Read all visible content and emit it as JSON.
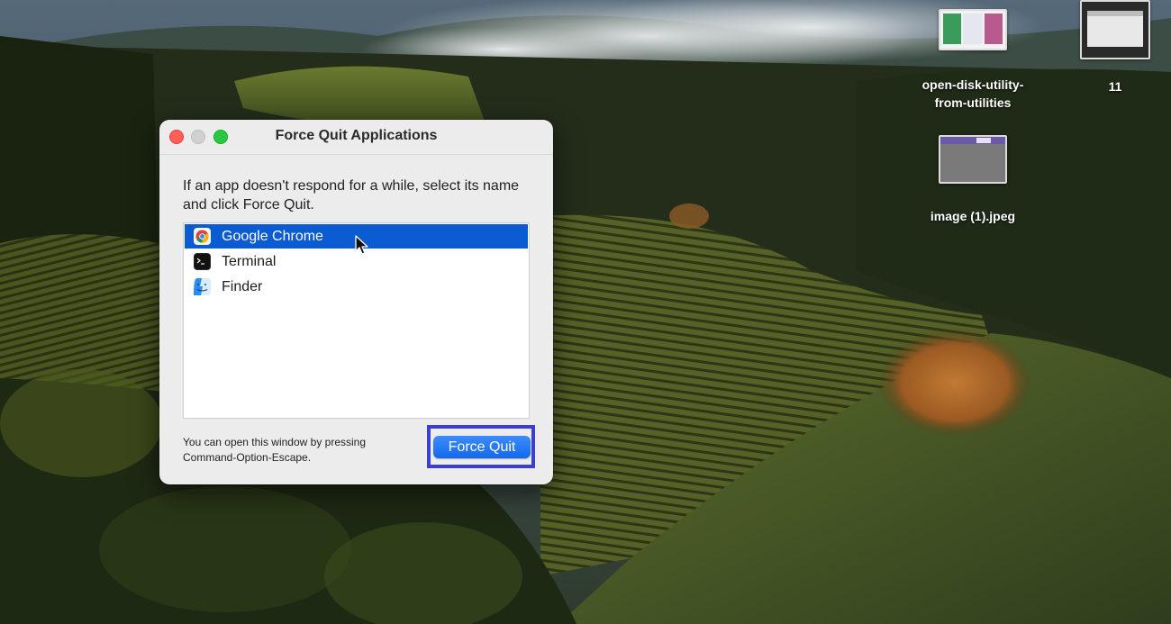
{
  "desktop": {
    "icons": [
      {
        "label_line1": "open-disk-utility-",
        "label_line2": "from-utilities"
      },
      {
        "label": "11"
      },
      {
        "label": "image (1).jpeg"
      }
    ]
  },
  "force_quit_window": {
    "title": "Force Quit Applications",
    "instructions": "If an app doesn't respond for a while, select its name and click Force Quit.",
    "apps": [
      {
        "name": "Google Chrome",
        "icon": "chrome-icon",
        "selected": true
      },
      {
        "name": "Terminal",
        "icon": "terminal-icon",
        "selected": false
      },
      {
        "name": "Finder",
        "icon": "finder-icon",
        "selected": false
      }
    ],
    "hint": "You can open this window by pressing Command-Option-Escape.",
    "force_quit_label": "Force Quit"
  },
  "colors": {
    "selection": "#0b5bd3",
    "button": "#1469ec",
    "highlight_box": "#3b3fc9",
    "close": "#fe5f57",
    "zoom": "#28c840"
  }
}
